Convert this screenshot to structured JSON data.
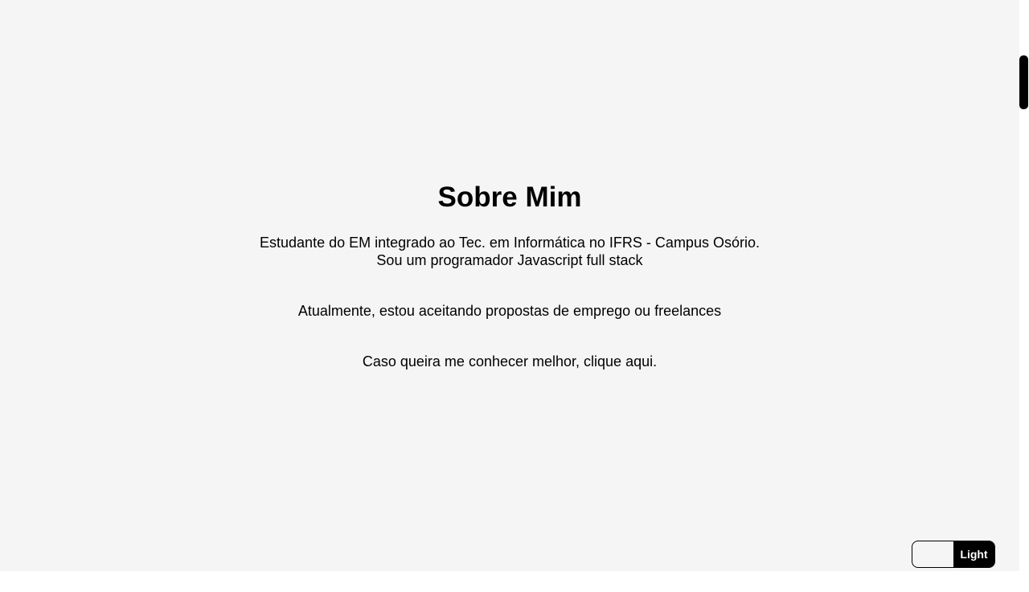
{
  "about": {
    "title": "Sobre Mim",
    "line1": "Estudante do EM integrado ao Tec. em Informática no IFRS - Campus Osório.",
    "line2": "Sou um programador Javascript full stack",
    "line3": "Atualmente, estou aceitando propostas de emprego ou freelances",
    "line4_prefix": "Caso queira me conhecer melhor, ",
    "line4_link": "clique aqui."
  },
  "theme_toggle": {
    "label": "Light",
    "active_color": "#000000",
    "background_color": "#f5f5f5"
  }
}
